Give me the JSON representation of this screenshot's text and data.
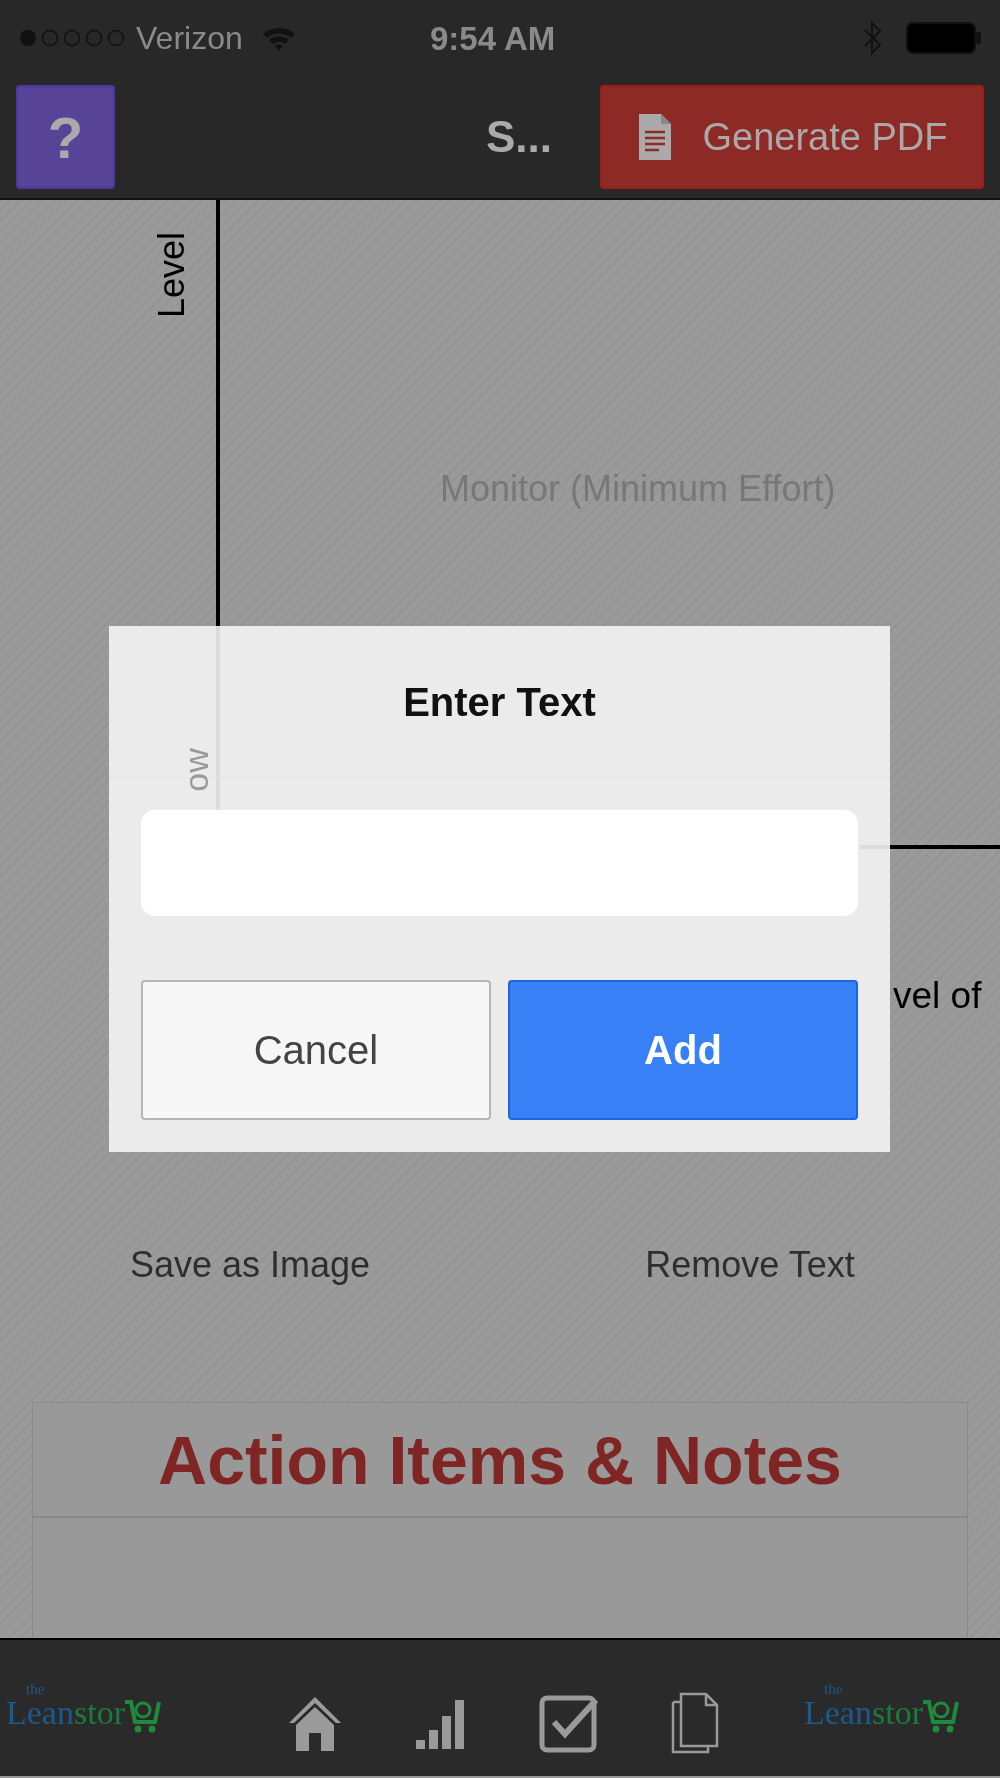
{
  "status_bar": {
    "carrier": "Verizon",
    "time": "9:54 AM"
  },
  "nav": {
    "help_label": "?",
    "title": "S...",
    "pdf_button": "Generate PDF"
  },
  "chart": {
    "y_axis_label": "Level",
    "quadrant_label": "Monitor (Minimum Effort)",
    "y_low_label": "ow",
    "x_axis_label": "vel of"
  },
  "dialog": {
    "title": "Enter Text",
    "buttons": [
      {
        "label": "Cancel",
        "kind": "secondary"
      },
      {
        "label": "Add",
        "kind": "primary"
      }
    ]
  },
  "actions": [
    "Save as Image",
    "Remove Text"
  ],
  "notes_card": {
    "title": "Action Items & Notes"
  },
  "tab_bar": {
    "logos": [
      {
        "small": "the",
        "word_1": "Lean",
        "word_2": "stor"
      },
      {
        "small": "the",
        "word_1": "Lean",
        "word_2": "stor"
      }
    ],
    "tabs": [
      {
        "kind": "home"
      },
      {
        "kind": "chart"
      },
      {
        "kind": "check"
      },
      {
        "kind": "pages"
      }
    ]
  }
}
